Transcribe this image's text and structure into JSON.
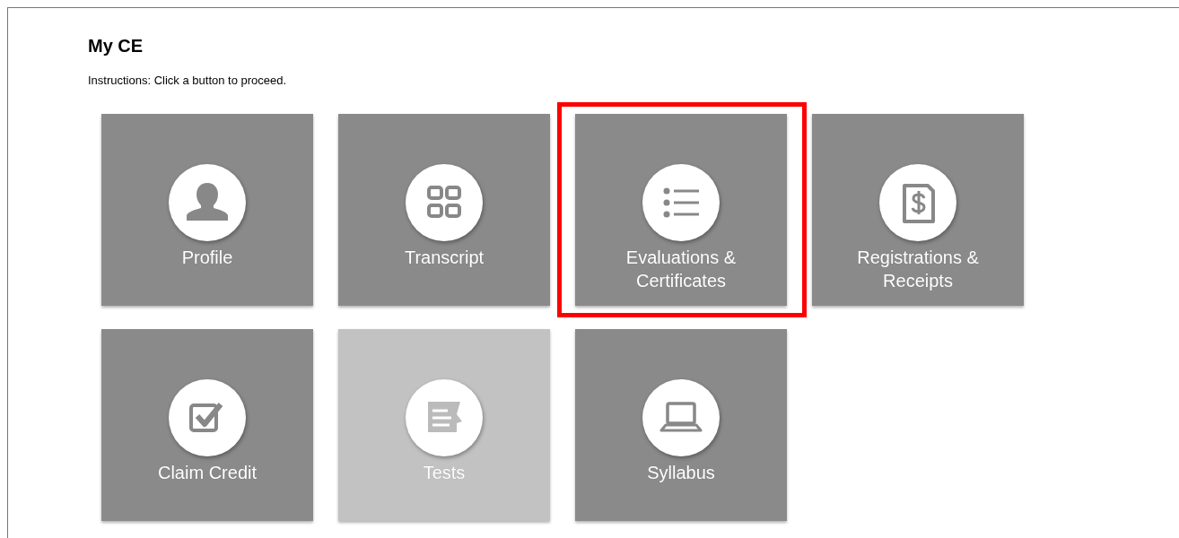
{
  "page": {
    "title": "My CE",
    "instructions": "Instructions: Click a button to proceed."
  },
  "tiles": [
    {
      "label": "Profile",
      "kind": "person",
      "disabled": false,
      "highlighted": false
    },
    {
      "label": "Transcript",
      "kind": "grid",
      "disabled": false,
      "highlighted": false
    },
    {
      "label": "Evaluations & Certificates",
      "kind": "list",
      "disabled": false,
      "highlighted": true
    },
    {
      "label": "Registrations & Receipts",
      "kind": "receipt",
      "disabled": false,
      "highlighted": false
    },
    {
      "label": "Claim Credit",
      "kind": "checkbox",
      "disabled": false,
      "highlighted": false
    },
    {
      "label": "Tests",
      "kind": "document",
      "disabled": true,
      "highlighted": false
    },
    {
      "label": "Syllabus",
      "kind": "laptop",
      "disabled": false,
      "highlighted": false
    }
  ]
}
